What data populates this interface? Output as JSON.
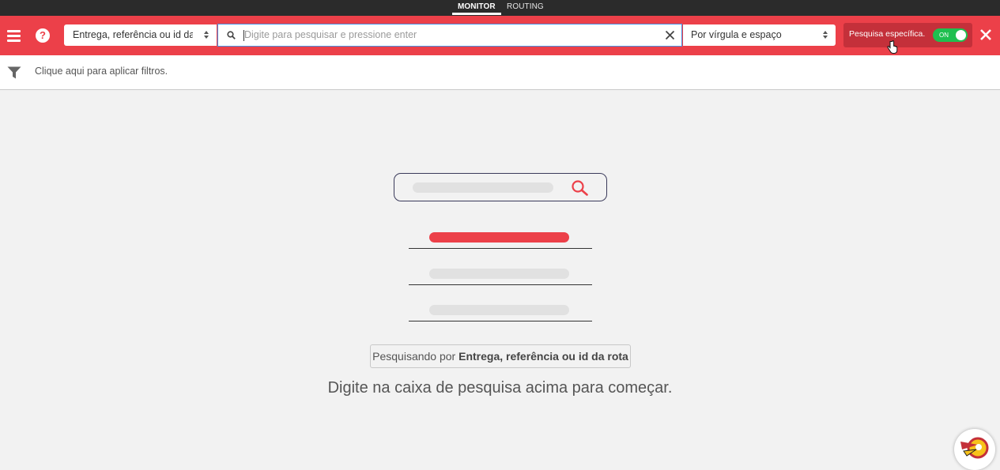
{
  "topnav": {
    "tabs": [
      {
        "label": "MONITOR",
        "active": true
      },
      {
        "label": "ROUTING",
        "active": false
      }
    ]
  },
  "toolbar": {
    "menu_icon": "hamburger-icon",
    "help_icon": "question-circle-icon",
    "help_glyph": "?",
    "search_field_select": "Entrega, referência ou id da rota",
    "search_placeholder": "Digite para pesquisar e pressione enter",
    "separator_select": "Por vírgula e espaço",
    "specific_label": "Pesquisa específica.",
    "specific_toggle": "ON",
    "close_icon": "close-icon"
  },
  "filters": {
    "icon": "filter-icon",
    "label": "Clique aqui para aplicar filtros."
  },
  "empty_state": {
    "searching_prefix": "Pesquisando por",
    "searching_field": "Entrega, referência ou id da rota",
    "hint": "Digite na caixa de pesquisa acima para começar."
  },
  "colors": {
    "brand": "#ec4049",
    "toggle_on": "#1fbf4f",
    "background": "#f2f2f2"
  }
}
